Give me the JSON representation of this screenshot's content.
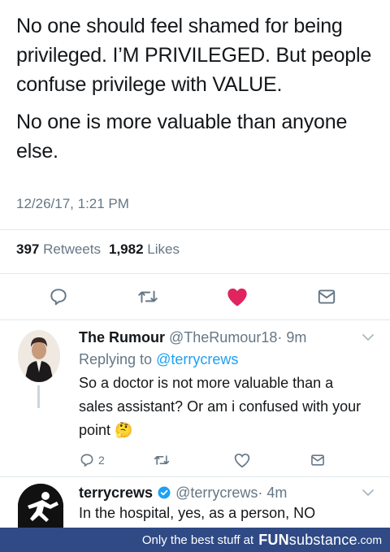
{
  "tweet": {
    "lines": [
      "No one should feel shamed for being privileged. I’M PRIVILEGED. But people confuse privilege with VALUE.",
      "No one is more valuable than anyone else."
    ],
    "timestamp": "12/26/17, 1:21 PM",
    "retweets_count": "397",
    "retweets_label": "Retweets",
    "likes_count": "1,982",
    "likes_label": "Likes"
  },
  "icons": {
    "reply": "reply-icon",
    "retweet": "retweet-icon",
    "like": "heart-icon",
    "share": "share-icon",
    "more": "chevron-down-icon",
    "verified": "verified-badge-icon",
    "emoji": "thinking-face-emoji"
  },
  "replies": [
    {
      "name": "The Rumour",
      "handle": "@TheRumour18",
      "age": "· 9m",
      "replying_prefix": "Replying to",
      "replying_to": "@terrycrews",
      "text": "So a doctor is not more valuable than a sales assistant? Or am i confused with your point",
      "emoji": "🤔",
      "reply_count": "2"
    },
    {
      "name": "terrycrews",
      "handle": "@terrycrews",
      "age": "· 4m",
      "text": "In the hospital, yes, as a person, NO"
    }
  ],
  "footer": {
    "tagline": "Only the best stuff at",
    "brand_main": "FUN",
    "brand_sub": "substance",
    "brand_domain": ".com"
  },
  "colors": {
    "text": "#14171a",
    "secondary": "#657786",
    "link": "#1da1f2",
    "like_red": "#e0245e",
    "footer_bg": "#2f4a85"
  }
}
